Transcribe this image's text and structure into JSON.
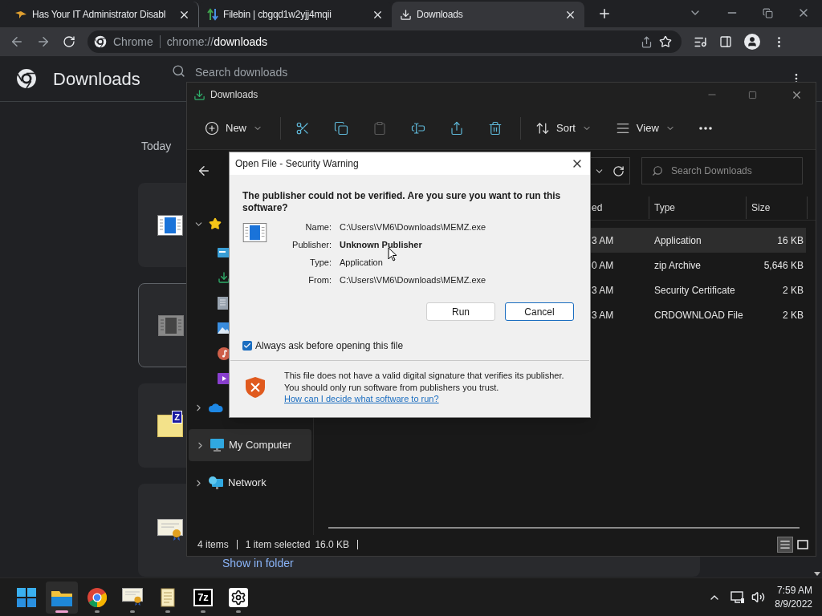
{
  "browser": {
    "tabs": [
      {
        "title": "Has Your IT Administrator Disabl",
        "kind": "bird",
        "selected": false
      },
      {
        "title": "Filebin | cbgqd1w2yjj4mqii",
        "kind": "arrows",
        "selected": false
      },
      {
        "title": "Downloads",
        "kind": "download",
        "selected": true
      }
    ],
    "omnibox": {
      "chip": "Chrome",
      "scheme": "chrome://",
      "path": "downloads"
    }
  },
  "downloads_page": {
    "title": "Downloads",
    "search": {
      "placeholder": "Search downloads"
    },
    "section": "Today",
    "cards": [
      {
        "kind": "exe",
        "hovered": false
      },
      {
        "kind": "film",
        "hovered": true
      },
      {
        "kind": "zip",
        "hovered": false,
        "icon_text": "Z"
      },
      {
        "kind": "cert",
        "hovered": false
      }
    ],
    "show_in_folder": "Show in folder"
  },
  "explorer": {
    "title": "Downloads",
    "toolbar": [
      {
        "kind": "new",
        "label": "New",
        "disabled": false
      },
      {
        "kind": "cut",
        "disabled": false
      },
      {
        "kind": "copy",
        "disabled": false
      },
      {
        "kind": "paste",
        "disabled": true
      },
      {
        "kind": "rename",
        "disabled": false
      },
      {
        "kind": "share",
        "disabled": false
      },
      {
        "kind": "delete",
        "disabled": false
      },
      {
        "kind": "sort",
        "label": "Sort",
        "disabled": false
      },
      {
        "kind": "view",
        "label": "View",
        "disabled": false
      },
      {
        "kind": "more",
        "disabled": false
      }
    ],
    "search": {
      "placeholder": "Search Downloads"
    },
    "nav": [
      {
        "kind": "quick-access",
        "expanded": true,
        "selected": false,
        "children": [
          {
            "kind": "desktop"
          },
          {
            "kind": "downloads"
          },
          {
            "kind": "documents"
          },
          {
            "kind": "pictures"
          },
          {
            "kind": "music"
          },
          {
            "kind": "videos"
          }
        ]
      },
      {
        "kind": "cloud",
        "expanded": false,
        "selected": false
      },
      {
        "kind": "computer",
        "label": "My Computer",
        "expanded": false,
        "selected": true
      },
      {
        "kind": "network",
        "label": "Network",
        "expanded": false,
        "selected": false
      }
    ],
    "columns": [
      "ed",
      "Type",
      "Size"
    ],
    "rows": [
      {
        "date": "3 AM",
        "type": "Application",
        "size": "16 KB",
        "selected": true
      },
      {
        "date": "0 AM",
        "type": "zip Archive",
        "size": "5,646 KB",
        "selected": false
      },
      {
        "date": "3 AM",
        "type": "Security Certificate",
        "size": "2 KB",
        "selected": false
      },
      {
        "date": "3 AM",
        "type": "CRDOWNLOAD File",
        "size": "2 KB",
        "selected": false
      }
    ],
    "status": {
      "count": "4 items",
      "selection": "1 item selected",
      "size": "16.0 KB"
    },
    "views": [
      {
        "kind": "details",
        "selected": true
      },
      {
        "kind": "tiles",
        "selected": false
      }
    ]
  },
  "dialog": {
    "title": "Open File - Security Warning",
    "question": "The publisher could not be verified.  Are you sure you want to run this software?",
    "fields": [
      {
        "label": "Name:",
        "value": "C:\\Users\\VM6\\Downloads\\MEMZ.exe",
        "bold": false
      },
      {
        "label": "Publisher:",
        "value": "Unknown Publisher",
        "bold": true
      },
      {
        "label": "Type:",
        "value": "Application",
        "bold": false
      },
      {
        "label": "From:",
        "value": "C:\\Users\\VM6\\Downloads\\MEMZ.exe",
        "bold": false
      }
    ],
    "buttons": [
      {
        "label": "Run",
        "focused": false
      },
      {
        "label": "Cancel",
        "focused": true
      }
    ],
    "always_ask": {
      "label": "Always ask before opening this file",
      "checked": true
    },
    "warning": "This file does not have a valid digital signature that verifies its publisher.  You should only run software from publishers you trust.",
    "link": "How can I decide what software to run?"
  },
  "taskbar": {
    "apps": [
      {
        "kind": "start",
        "running": false,
        "active": false
      },
      {
        "kind": "explorer",
        "running": true,
        "active": true
      },
      {
        "kind": "chrome",
        "running": true,
        "active": false
      },
      {
        "kind": "certificate",
        "running": true,
        "active": false
      },
      {
        "kind": "notepad",
        "running": true,
        "active": false
      },
      {
        "kind": "archiver",
        "icon_text": "7z",
        "running": true,
        "active": false
      },
      {
        "kind": "settings",
        "running": true,
        "active": false
      }
    ],
    "time": "7:59 AM",
    "date": "8/9/2022"
  }
}
